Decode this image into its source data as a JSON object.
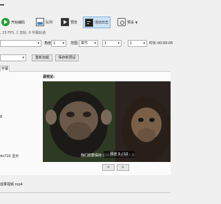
{
  "toolbar": {
    "start_encode": "开始编码",
    "queue": "队列",
    "preview": "预览",
    "activity_log": "活动日志",
    "presets": "预设"
  },
  "source_info": ", 25 FPS, 1 音轨, 0 字幕轨道",
  "range": {
    "angle_label": "角度:",
    "angle_value": "1",
    "range_label": "范围:",
    "range_type": "章节",
    "start": "1",
    "dash": "-",
    "end": "1",
    "duration_label": "时长:",
    "duration_value": "00:00:05"
  },
  "preset_buttons": {
    "reload": "重新加载",
    "save_new": "保存新预设"
  },
  "tabs": {
    "subtitles": "字幕"
  },
  "left_panel": {
    "partial_1": "8",
    "partial_2": "4x720 显示"
  },
  "preview": {
    "title": "源预览:",
    "subtitle_text": "我们想要保持 这种简单 的原始人类",
    "overlay": "预览 5 / 10",
    "prev": "<",
    "next": ">"
  },
  "output_file": "成果视频.mp4",
  "colors": {
    "accent": "#cfe3f6",
    "play_green": "#2a9d3a"
  },
  "icons": {
    "start": "play-icon",
    "queue": "queue-icon",
    "preview": "preview-icon",
    "log": "terminal-icon",
    "presets": "gear-icon"
  }
}
